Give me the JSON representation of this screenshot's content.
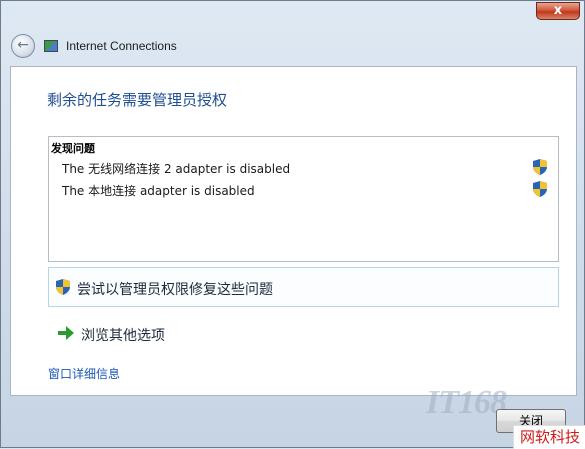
{
  "window": {
    "close_glyph": "x"
  },
  "nav": {
    "back_glyph": "←",
    "title": "Internet Connections"
  },
  "main": {
    "heading": "剩余的任务需要管理员授权",
    "problems": {
      "title": "发现问题",
      "items": [
        {
          "text": "The 无线网络连接 2 adapter is disabled",
          "icon": "uac-shield-icon"
        },
        {
          "text": "The 本地连接 adapter is disabled",
          "icon": "uac-shield-icon"
        }
      ]
    },
    "fix_option": {
      "label": "尝试以管理员权限修复这些问题",
      "icon": "uac-shield-icon"
    },
    "browse_option": {
      "label": "浏览其他选项",
      "icon": "green-arrow-icon"
    },
    "details_link": "窗口详细信息"
  },
  "footer": {
    "close_label": "关闭",
    "watermark": "IT168",
    "corner_text": "网软科技"
  },
  "colors": {
    "heading": "#1f4e91",
    "link": "#1c57b5",
    "arrow": "#2c9b2f",
    "corner_text": "#d11a1a"
  }
}
